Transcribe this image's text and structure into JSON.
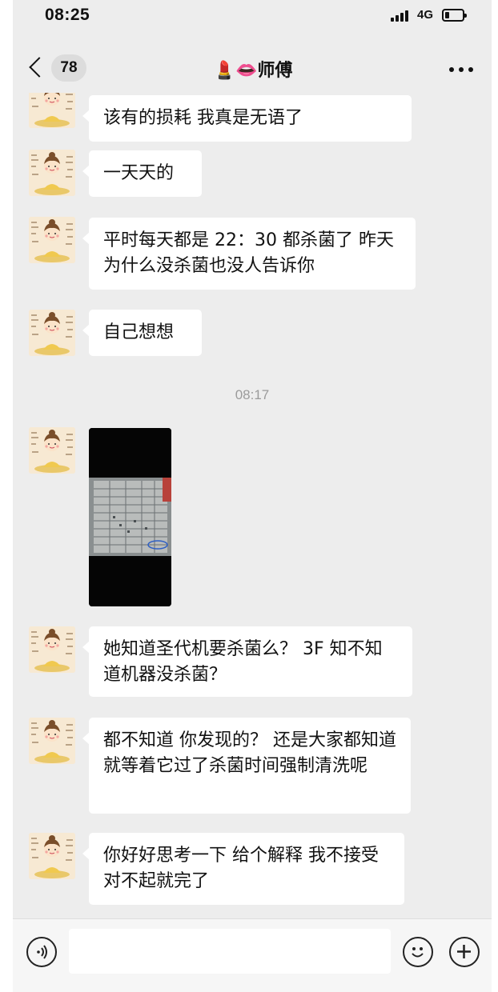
{
  "status_bar": {
    "time": "08:25",
    "network": "4G",
    "battery_level": 0.25
  },
  "nav": {
    "unread_count": "78",
    "title": "💄👄师傅"
  },
  "messages": [
    {
      "text": "该有的损耗  我真是无语了"
    },
    {
      "text": "一天天的"
    },
    {
      "text": "平时每天都是 22：30 都杀菌了 昨天为什么没杀菌也没人告诉你"
    },
    {
      "text": "自己想想"
    },
    {
      "timestamp": "08:17"
    },
    {
      "image": "photo-of-paper-log-sheet"
    },
    {
      "text": "她知道圣代机要杀菌么？  3F 知不知道机器没杀菌？"
    },
    {
      "text": "都不知道  你发现的？  还是大家都知道  就等着它过了杀菌时间强制清洗呢"
    },
    {
      "text": "你好好思考一下   给个解释   我不接受对不起就完了"
    }
  ],
  "input_bar": {
    "voice_icon": "voice-icon",
    "emoji_icon": "emoji-icon",
    "plus_icon": "plus-icon",
    "input_value": ""
  },
  "colors": {
    "background": "#ededed",
    "bubble": "#ffffff",
    "timestamp": "#9b9b9b"
  }
}
